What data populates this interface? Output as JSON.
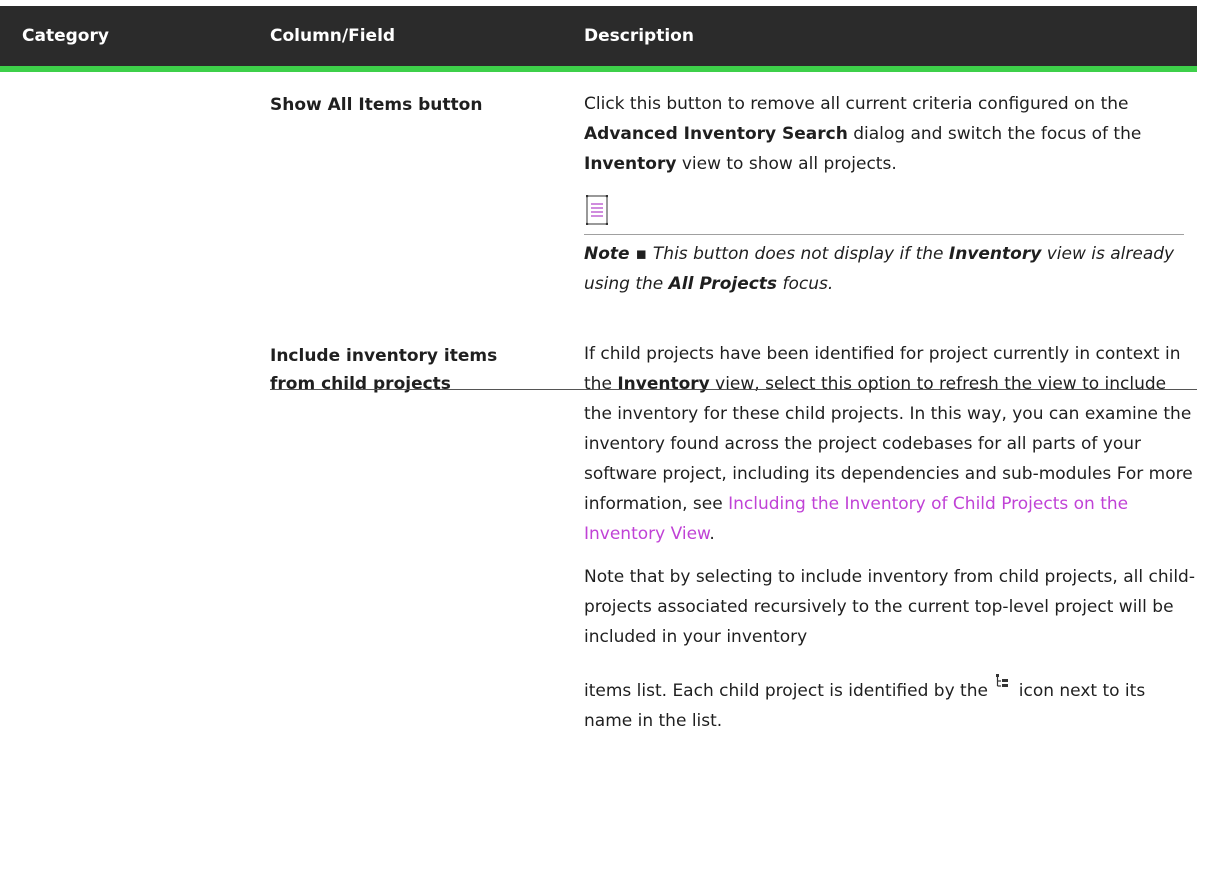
{
  "header": {
    "col1": "Category",
    "col2": "Column/Field",
    "col3": "Description"
  },
  "rows": [
    {
      "field": "Show All Items button",
      "desc": {
        "t1": "Click this button to remove all current criteria configured on the ",
        "b1": "Advanced Inventory Search",
        "t2": " dialog and switch the focus of the ",
        "b2": "Inventory",
        "t3": " view to show all projects."
      },
      "note": {
        "icon": "note-icon",
        "prefix": "Note ▪ ",
        "t1": "This button does not display if the ",
        "b1": "Inventory",
        "t2": " view is already using the ",
        "b2": "All Projects",
        "t3": " focus."
      }
    },
    {
      "field_line1": "Include inventory items",
      "field_line2": "from child projects",
      "desc": {
        "t1": "If child projects have been identified for project currently in context in the ",
        "b1": "Inventory",
        "t2": " view, select this option to refresh the view to include the inventory for these child projects. In this way, you can examine the inventory found across the project codebases for all parts of your software project, including its dependencies and sub-modules For more information, see ",
        "link": "Including the Inventory of Child Projects on the Inventory View",
        "t3": "."
      },
      "para2": "Note that by selecting to include inventory from child projects, all child-projects associated recursively to the current top-level project will be included in your inventory",
      "para3_a": "items list. Each child project is identified by the ",
      "para3_icon": "child-project-icon",
      "para3_b": " icon next to its name in the list."
    }
  ]
}
